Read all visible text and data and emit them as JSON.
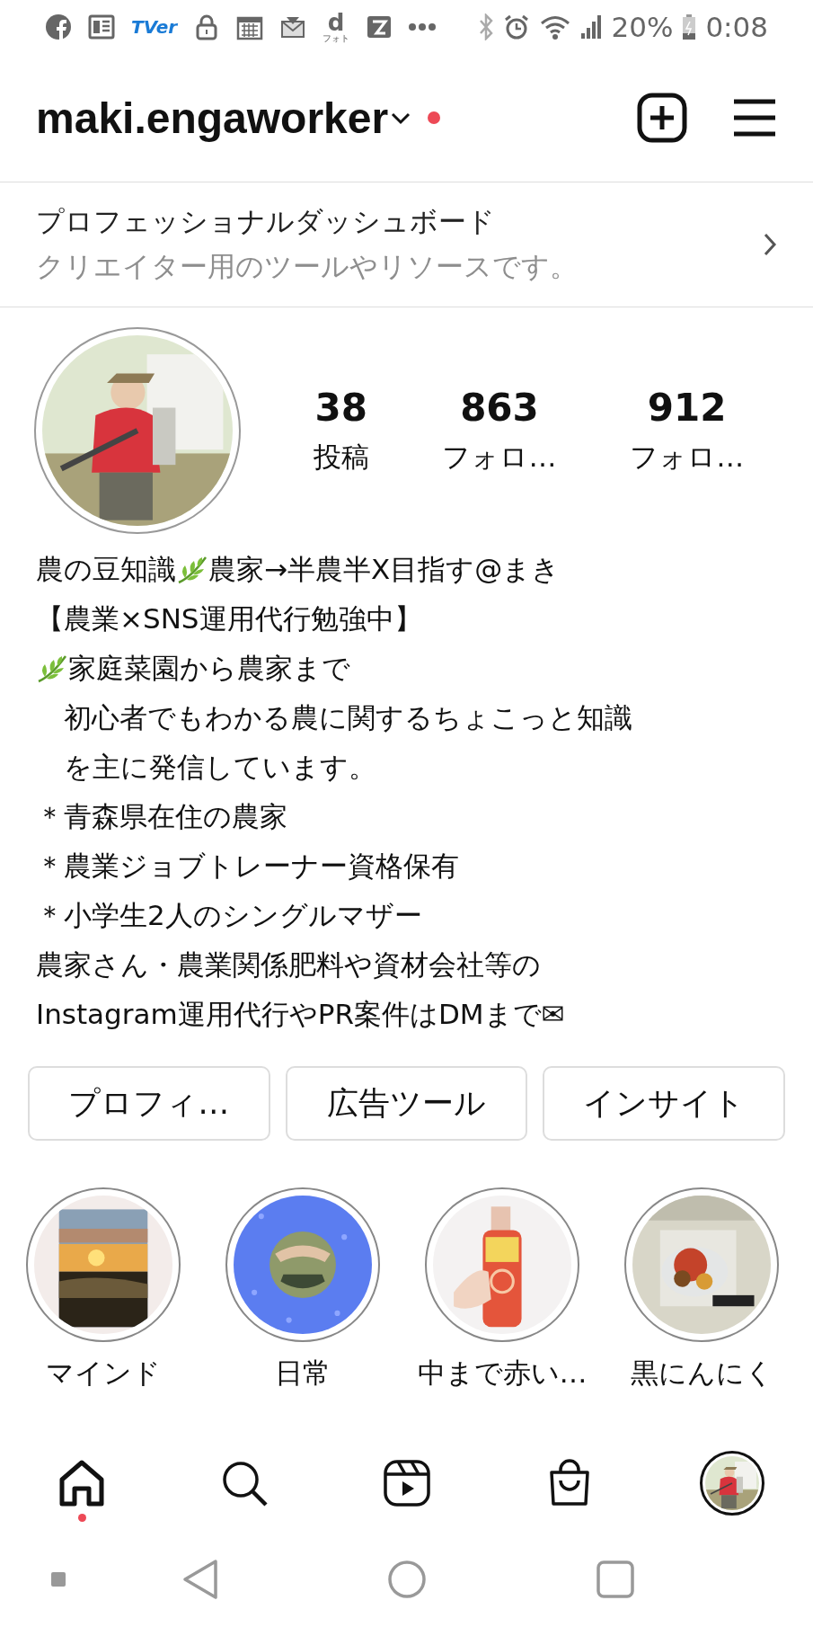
{
  "status_bar": {
    "notifications": [
      {
        "kind": "facebook"
      },
      {
        "kind": "news"
      },
      {
        "kind": "tver",
        "label": "TVer"
      },
      {
        "kind": "lock"
      },
      {
        "kind": "calendar"
      },
      {
        "kind": "mail"
      },
      {
        "kind": "dphoto",
        "label": "d",
        "sublabel": "フォト"
      },
      {
        "kind": "zbox"
      },
      {
        "kind": "more"
      }
    ],
    "battery": "20%",
    "time": "0:08"
  },
  "header": {
    "username": "maki.engaworker",
    "has_notification": true
  },
  "dashboard": {
    "title": "プロフェッショナルダッシュボード",
    "subtitle": "クリエイター用のツールやリソースです。"
  },
  "stats": [
    {
      "value": "38",
      "label": "投稿"
    },
    {
      "value": "863",
      "label": "フォロ…"
    },
    {
      "value": "912",
      "label": "フォロ…"
    }
  ],
  "bio": [
    [
      {
        "text": "農の豆知識"
      },
      {
        "kind": "leaf"
      },
      {
        "text": "農家→半農半X目指す@まき"
      }
    ],
    [
      {
        "text": "【農業×SNS運用代行勉強中】"
      }
    ],
    [
      {
        "kind": "leaf"
      },
      {
        "text": "家庭菜園から農家まで"
      }
    ],
    [
      {
        "text": "　初心者でもわかる農に関するちょこっと知識"
      }
    ],
    [
      {
        "text": "　を主に発信しています。"
      }
    ],
    [
      {
        "text": "＊青森県在住の農家"
      }
    ],
    [
      {
        "text": "＊農業ジョブトレーナー資格保有"
      }
    ],
    [
      {
        "text": "＊小学生2人のシングルマザー"
      }
    ],
    [
      {
        "text": "農家さん・農業関係肥料や資材会社等の"
      }
    ],
    [
      {
        "text": "Instagram運用代行やPR案件はDMまで✉"
      }
    ]
  ],
  "buttons": [
    "プロフィ…",
    "広告ツール",
    "インサイト"
  ],
  "highlights": [
    {
      "label": "マインド",
      "kind": "sunset"
    },
    {
      "label": "日常",
      "kind": "dots"
    },
    {
      "label": "中まで赤い…",
      "kind": "bottle"
    },
    {
      "label": "黒にんにく",
      "kind": "food"
    }
  ],
  "tab_bar": [
    {
      "kind": "home",
      "selected": true,
      "badge": true
    },
    {
      "kind": "search",
      "selected": false,
      "badge": false
    },
    {
      "kind": "reels",
      "selected": false,
      "badge": false
    },
    {
      "kind": "shop",
      "selected": false,
      "badge": false
    },
    {
      "kind": "profile",
      "selected": false,
      "badge": false
    }
  ]
}
